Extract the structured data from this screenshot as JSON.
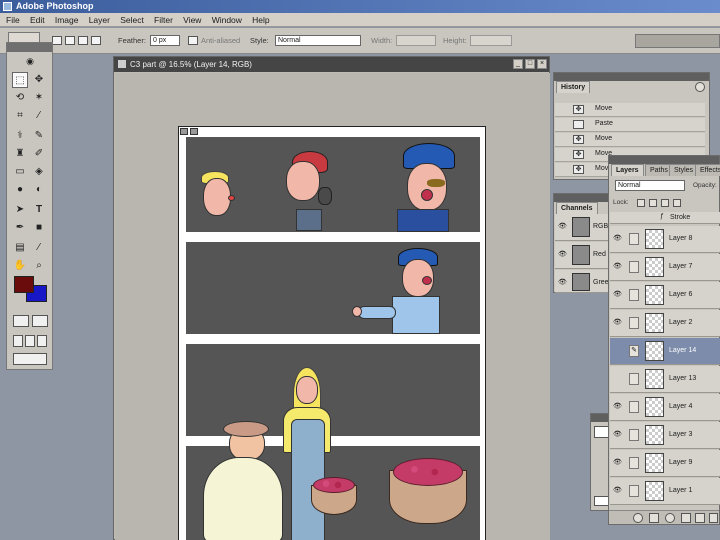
{
  "window": {
    "title": "Adobe Photoshop"
  },
  "menu": [
    "File",
    "Edit",
    "Image",
    "Layer",
    "Select",
    "Filter",
    "View",
    "Window",
    "Help"
  ],
  "options": {
    "feather_label": "Feather:",
    "feather_value": "0 px",
    "antialiased_label": "Anti-aliased",
    "style_label": "Style:",
    "style_value": "Normal",
    "width_label": "Width:",
    "height_label": "Height:"
  },
  "colors": {
    "foreground": "#6b0c0c",
    "background": "#1717c8"
  },
  "document": {
    "title": "C3 part @ 16.5% (Layer 14, RGB)",
    "minimize": "_",
    "maximize": "□",
    "close": "×"
  },
  "history": {
    "tab": "History",
    "items": [
      "Move",
      "Paste",
      "Move",
      "Move",
      "Move"
    ]
  },
  "channels": {
    "tab": "Channels",
    "items": [
      "RGB",
      "Red",
      "Green"
    ]
  },
  "layers": {
    "tabs": [
      "Layers",
      "Paths",
      "Styles",
      "Effects"
    ],
    "blend_mode": "Normal",
    "opacity_label": "Opacity:",
    "lock_label": "Lock:",
    "stroke_label": "Stroke",
    "items": [
      {
        "name": "Layer 8",
        "visible": true,
        "selected": false
      },
      {
        "name": "Layer 7",
        "visible": true,
        "selected": false
      },
      {
        "name": "Layer 6",
        "visible": true,
        "selected": false
      },
      {
        "name": "Layer 2",
        "visible": true,
        "selected": false
      },
      {
        "name": "Layer 14",
        "visible": false,
        "selected": true
      },
      {
        "name": "Layer 13",
        "visible": false,
        "selected": false
      },
      {
        "name": "Layer 4",
        "visible": true,
        "selected": false
      },
      {
        "name": "Layer 3",
        "visible": true,
        "selected": false
      },
      {
        "name": "Layer 9",
        "visible": true,
        "selected": false
      },
      {
        "name": "Layer 1",
        "visible": true,
        "selected": false
      }
    ]
  },
  "icons": {
    "eye": "👁",
    "brush": "✎",
    "move": "✥",
    "text": "T",
    "hand": "✋",
    "zoom": "🔍"
  }
}
